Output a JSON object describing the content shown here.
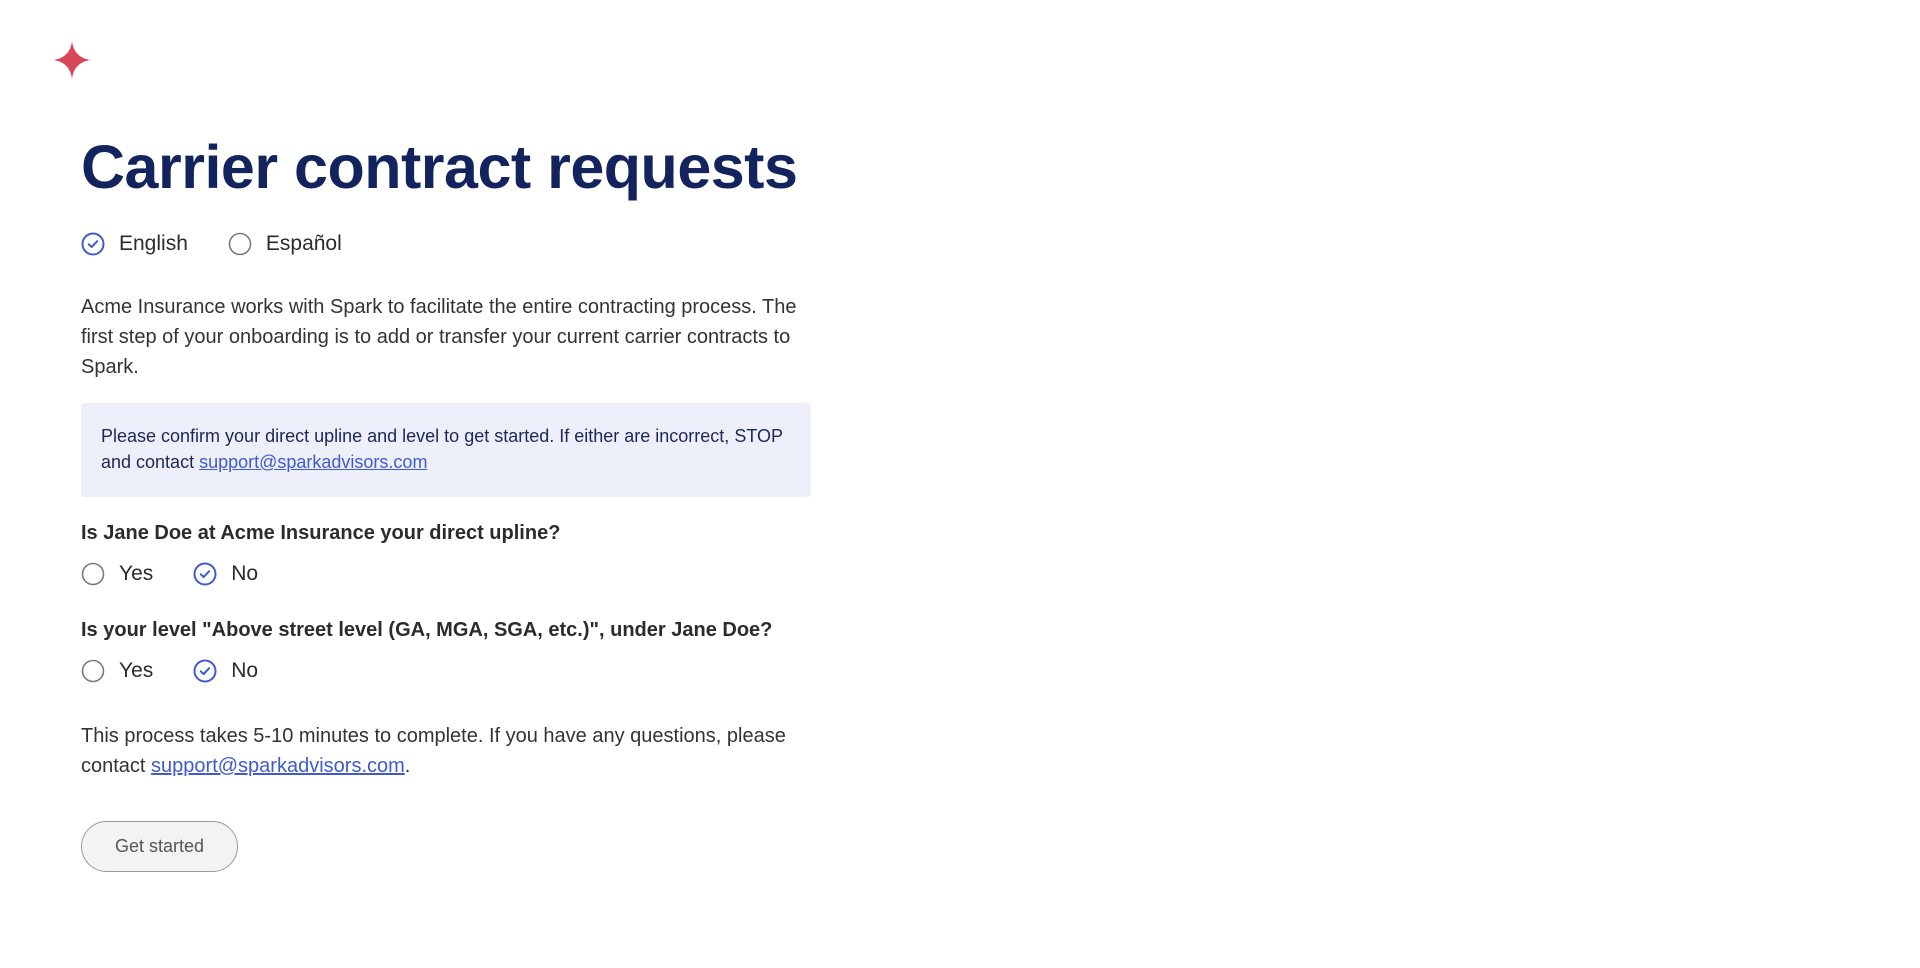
{
  "brand": {
    "logo_icon": "sparkle-star-icon",
    "logo_color": "#d9475a"
  },
  "page": {
    "title": "Carrier contract requests"
  },
  "language": {
    "options": [
      {
        "label": "English",
        "selected": true
      },
      {
        "label": "Español",
        "selected": false
      }
    ]
  },
  "intro": {
    "text": "Acme Insurance works with Spark to facilitate the entire contracting process. The first step of your onboarding is to add or transfer your current carrier contracts to Spark."
  },
  "notice": {
    "text": "Please confirm your direct upline and level to get started. If either are incorrect, STOP and contact ",
    "email": "support@sparkadvisors.com"
  },
  "questions": [
    {
      "text": "Is Jane Doe at Acme Insurance your direct upline?",
      "options": [
        {
          "label": "Yes",
          "selected": false
        },
        {
          "label": "No",
          "selected": true
        }
      ]
    },
    {
      "text": "Is your level \"Above street level (GA, MGA, SGA, etc.)\", under Jane Doe?",
      "options": [
        {
          "label": "Yes",
          "selected": false
        },
        {
          "label": "No",
          "selected": true
        }
      ]
    }
  ],
  "outro": {
    "text": "This process takes 5-10 minutes to complete. If you have any questions, please contact ",
    "email": "support@sparkadvisors.com",
    "suffix": "."
  },
  "actions": {
    "start_label": "Get started"
  },
  "colors": {
    "title": "#13235e",
    "radio_selected": "#3f5ad0",
    "radio_unselected": "#7a7a7a",
    "notice_bg": "#edf0fb",
    "link": "#3f5ad0"
  }
}
